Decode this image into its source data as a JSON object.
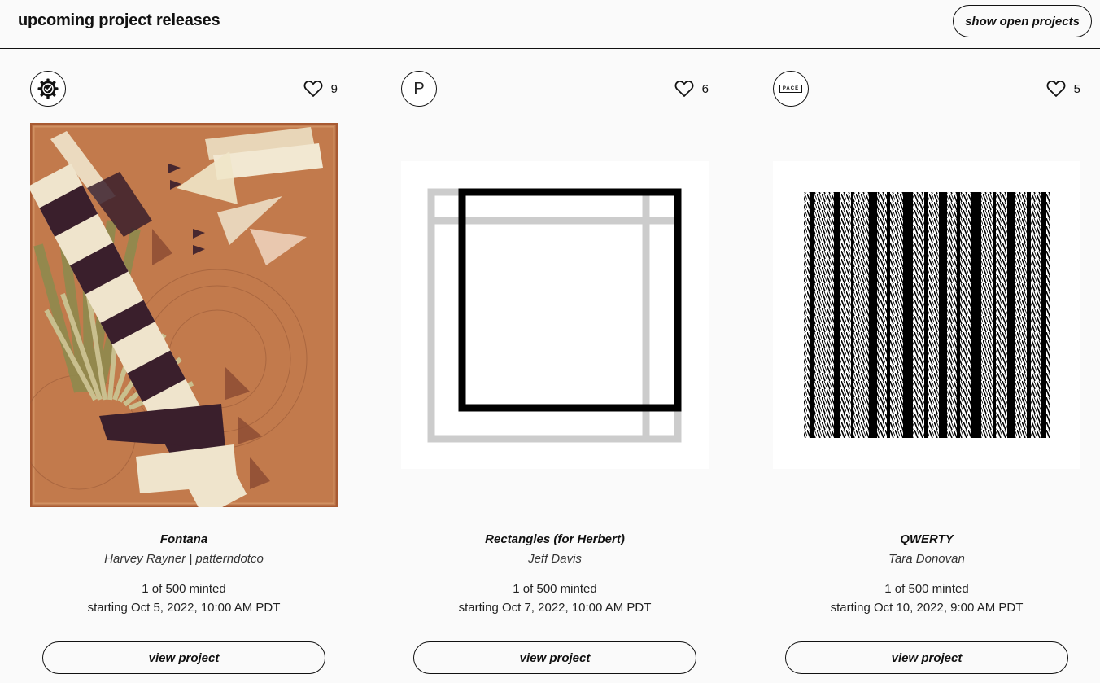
{
  "header": {
    "title": "upcoming project releases",
    "open_projects_label": "show open projects"
  },
  "projects": [
    {
      "avatar": "verified-badge-icon",
      "likes": "9",
      "title": "Fontana",
      "artist": "Harvey Rayner | patterndotco",
      "minted": "1 of 500 minted",
      "start": "starting Oct 5, 2022, 10:00 AM PDT",
      "button": "view project",
      "art_colors": {
        "background": "#c07848",
        "frame": "#a85a32",
        "dark": "#3a1f2c",
        "light": "#efe4cc",
        "olive": "#8f8a4e"
      }
    },
    {
      "avatar": "P",
      "likes": "6",
      "title": "Rectangles (for Herbert)",
      "artist": "Jeff Davis",
      "minted": "1 of 500 minted",
      "start": "starting Oct 7, 2022, 10:00 AM PDT",
      "button": "view project",
      "art_colors": {
        "background": "#ffffff",
        "gray": "#cccccc",
        "black": "#000000"
      }
    },
    {
      "avatar": "PACE",
      "likes": "5",
      "title": "QWERTY",
      "artist": "Tara Donovan",
      "minted": "1 of 500 minted",
      "start": "starting Oct 10, 2022, 9:00 AM PDT",
      "button": "view project",
      "art_colors": {
        "background": "#ffffff",
        "ink": "#000000"
      }
    }
  ]
}
